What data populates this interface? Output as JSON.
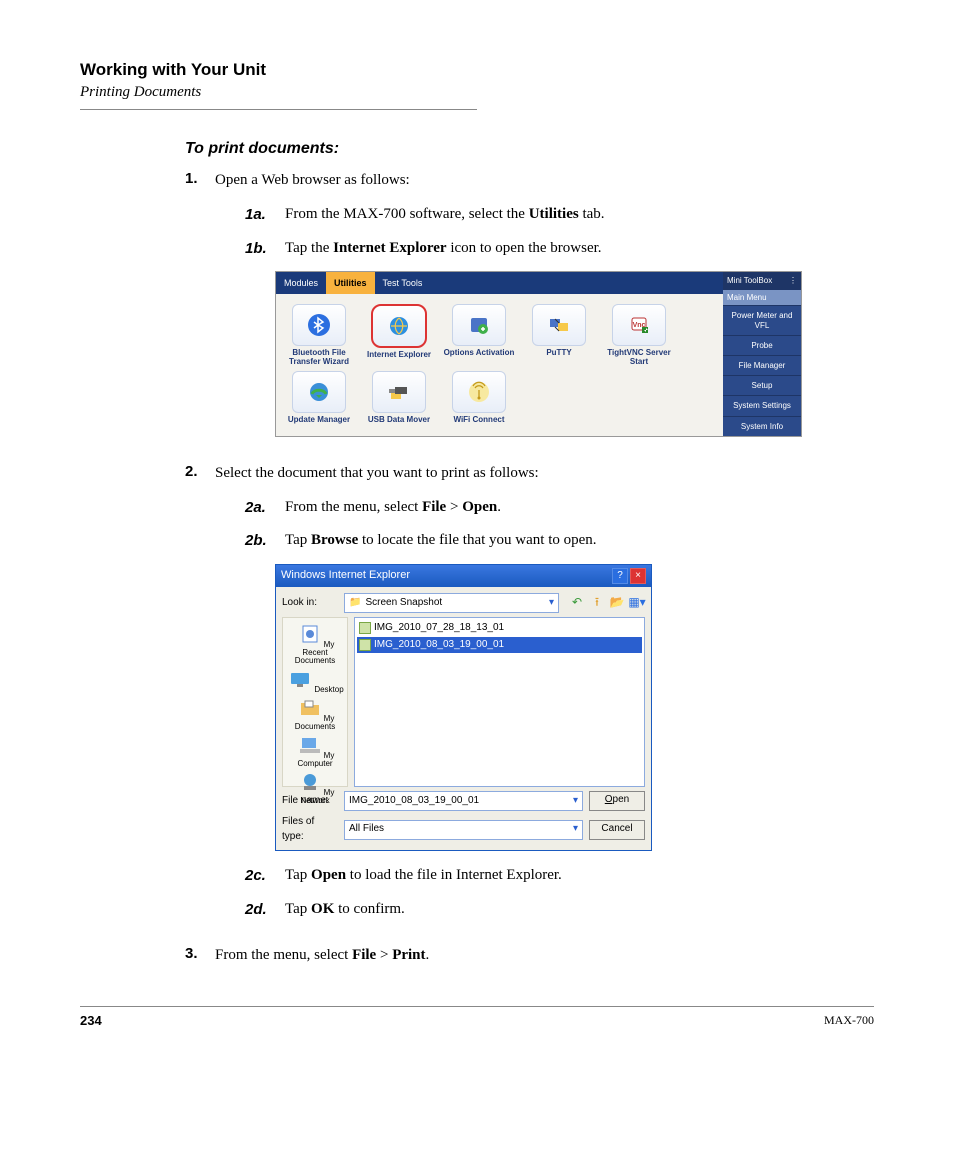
{
  "header": {
    "title": "Working with Your Unit",
    "subtitle": "Printing Documents"
  },
  "section_heading": "To print documents:",
  "steps": {
    "s1": {
      "num": "1.",
      "text_a": "Open a Web browser as follows:"
    },
    "s1a": {
      "num": "1a.",
      "text_a": "From the MAX-700 software, select the ",
      "b1": "Utilities",
      "text_b": " tab."
    },
    "s1b": {
      "num": "1b.",
      "text_a": "Tap the ",
      "b1": "Internet Explorer",
      "text_b": " icon to open the browser."
    },
    "s2": {
      "num": "2.",
      "text_a": "Select the document that you want to print as follows:"
    },
    "s2a": {
      "num": "2a.",
      "text_a": "From the menu, select ",
      "b1": "File",
      "text_b": " > ",
      "b2": "Open",
      "text_c": "."
    },
    "s2b": {
      "num": "2b.",
      "text_a": "Tap ",
      "b1": "Browse",
      "text_b": " to locate the file that you want to open."
    },
    "s2c": {
      "num": "2c.",
      "text_a": "Tap ",
      "b1": "Open",
      "text_b": " to load the file in Internet Explorer."
    },
    "s2d": {
      "num": "2d.",
      "text_a": "Tap ",
      "b1": "OK",
      "text_b": " to confirm."
    },
    "s3": {
      "num": "3.",
      "text_a": "From the menu, select ",
      "b1": "File",
      "text_b": " > ",
      "b2": "Print",
      "text_c": "."
    }
  },
  "fig1": {
    "tabs": [
      "Modules",
      "Utilities",
      "Test Tools"
    ],
    "items": [
      "Bluetooth File Transfer Wizard",
      "Internet Explorer",
      "Options Activation",
      "PuTTY",
      "TightVNC Server Start",
      "Update Manager",
      "USB Data Mover",
      "WiFi Connect"
    ],
    "side_title": "Mini ToolBox",
    "side_mainmenu": "Main Menu",
    "side_btns": [
      "Power Meter and VFL",
      "Probe",
      "File Manager",
      "Setup",
      "System Settings",
      "System Info"
    ]
  },
  "fig2": {
    "title": "Windows Internet Explorer",
    "lookin_label": "Look in:",
    "lookin_value": "Screen Snapshot",
    "places": [
      "My Recent Documents",
      "Desktop",
      "My Documents",
      "My Computer",
      "My Network"
    ],
    "files": [
      "IMG_2010_07_28_18_13_01",
      "IMG_2010_08_03_19_00_01"
    ],
    "fn_label": "File name:",
    "fn_value": "IMG_2010_08_03_19_00_01",
    "ft_label": "Files of type:",
    "ft_value": "All Files",
    "open_btn": "Open",
    "cancel_btn": "Cancel"
  },
  "footer": {
    "page": "234",
    "model": "MAX-700"
  }
}
